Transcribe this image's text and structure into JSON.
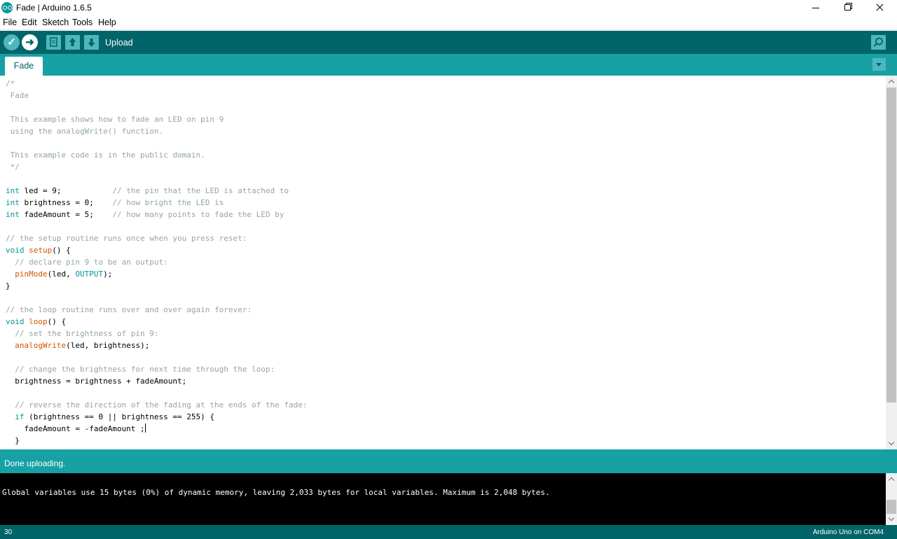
{
  "window": {
    "title": "Fade | Arduino 1.6.5"
  },
  "menu": {
    "items": [
      "File",
      "Edit",
      "Sketch",
      "Tools",
      "Help"
    ]
  },
  "toolbar": {
    "status_label": "Upload",
    "buttons": [
      "verify-icon",
      "upload-icon",
      "new-icon",
      "open-icon",
      "save-icon",
      "serial-monitor-icon"
    ]
  },
  "tabs": [
    {
      "label": "Fade",
      "active": true
    }
  ],
  "editor": {
    "lines": [
      [
        {
          "t": "/*",
          "c": "comment"
        }
      ],
      [
        {
          "t": " Fade",
          "c": "comment"
        }
      ],
      [],
      [
        {
          "t": " This example shows how to fade an LED on pin 9",
          "c": "comment"
        }
      ],
      [
        {
          "t": " using the analogWrite() function.",
          "c": "comment"
        }
      ],
      [],
      [
        {
          "t": " This example code is in the public domain.",
          "c": "comment"
        }
      ],
      [
        {
          "t": " */",
          "c": "comment"
        }
      ],
      [],
      [
        {
          "t": "int",
          "c": "kw"
        },
        {
          "t": " led = 9;           "
        },
        {
          "t": "// the pin that the LED is attached to",
          "c": "comment"
        }
      ],
      [
        {
          "t": "int",
          "c": "kw"
        },
        {
          "t": " brightness = 0;    "
        },
        {
          "t": "// how bright the LED is",
          "c": "comment"
        }
      ],
      [
        {
          "t": "int",
          "c": "kw"
        },
        {
          "t": " fadeAmount = 5;    "
        },
        {
          "t": "// how many points to fade the LED by",
          "c": "comment"
        }
      ],
      [],
      [
        {
          "t": "// the setup routine runs once when you press reset:",
          "c": "comment"
        }
      ],
      [
        {
          "t": "void",
          "c": "kw"
        },
        {
          "t": " "
        },
        {
          "t": "setup",
          "c": "fn"
        },
        {
          "t": "() {"
        }
      ],
      [
        {
          "t": "  "
        },
        {
          "t": "// declare pin 9 to be an output:",
          "c": "comment"
        }
      ],
      [
        {
          "t": "  "
        },
        {
          "t": "pinMode",
          "c": "fn"
        },
        {
          "t": "(led, "
        },
        {
          "t": "OUTPUT",
          "c": "const"
        },
        {
          "t": ");"
        }
      ],
      [
        {
          "t": "}"
        }
      ],
      [],
      [
        {
          "t": "// the loop routine runs over and over again forever:",
          "c": "comment"
        }
      ],
      [
        {
          "t": "void",
          "c": "kw"
        },
        {
          "t": " "
        },
        {
          "t": "loop",
          "c": "fn"
        },
        {
          "t": "() {"
        }
      ],
      [
        {
          "t": "  "
        },
        {
          "t": "// set the brightness of pin 9:",
          "c": "comment"
        }
      ],
      [
        {
          "t": "  "
        },
        {
          "t": "analogWrite",
          "c": "fn"
        },
        {
          "t": "(led, brightness);"
        }
      ],
      [],
      [
        {
          "t": "  "
        },
        {
          "t": "// change the brightness for next time through the loop:",
          "c": "comment"
        }
      ],
      [
        {
          "t": "  brightness = brightness + fadeAmount;"
        }
      ],
      [],
      [
        {
          "t": "  "
        },
        {
          "t": "// reverse the direction of the fading at the ends of the fade:",
          "c": "comment"
        }
      ],
      [
        {
          "t": "  "
        },
        {
          "t": "if",
          "c": "kw"
        },
        {
          "t": " (brightness == 0 || brightness == 255) {"
        }
      ],
      [
        {
          "t": "    fadeAmount = -fadeAmount ;"
        },
        {
          "t": "",
          "c": "caret"
        }
      ],
      [
        {
          "t": "  }"
        }
      ]
    ]
  },
  "status": {
    "message": "Done uploading."
  },
  "console": {
    "residue": "          ·   ·      ·     ·      ·              ·       ·       ·          ·",
    "text": "Global variables use 15 bytes (0%) of dynamic memory, leaving 2,033 bytes for local variables. Maximum is 2,048 bytes."
  },
  "footer": {
    "line": "30",
    "board": "Arduino Uno on COM4"
  },
  "colors": {
    "toolbar": "#006468",
    "tabbar": "#17a1a5",
    "button": "#4db7bb",
    "keyword": "#00979c",
    "function": "#d35400",
    "comment": "#95a5a6"
  }
}
